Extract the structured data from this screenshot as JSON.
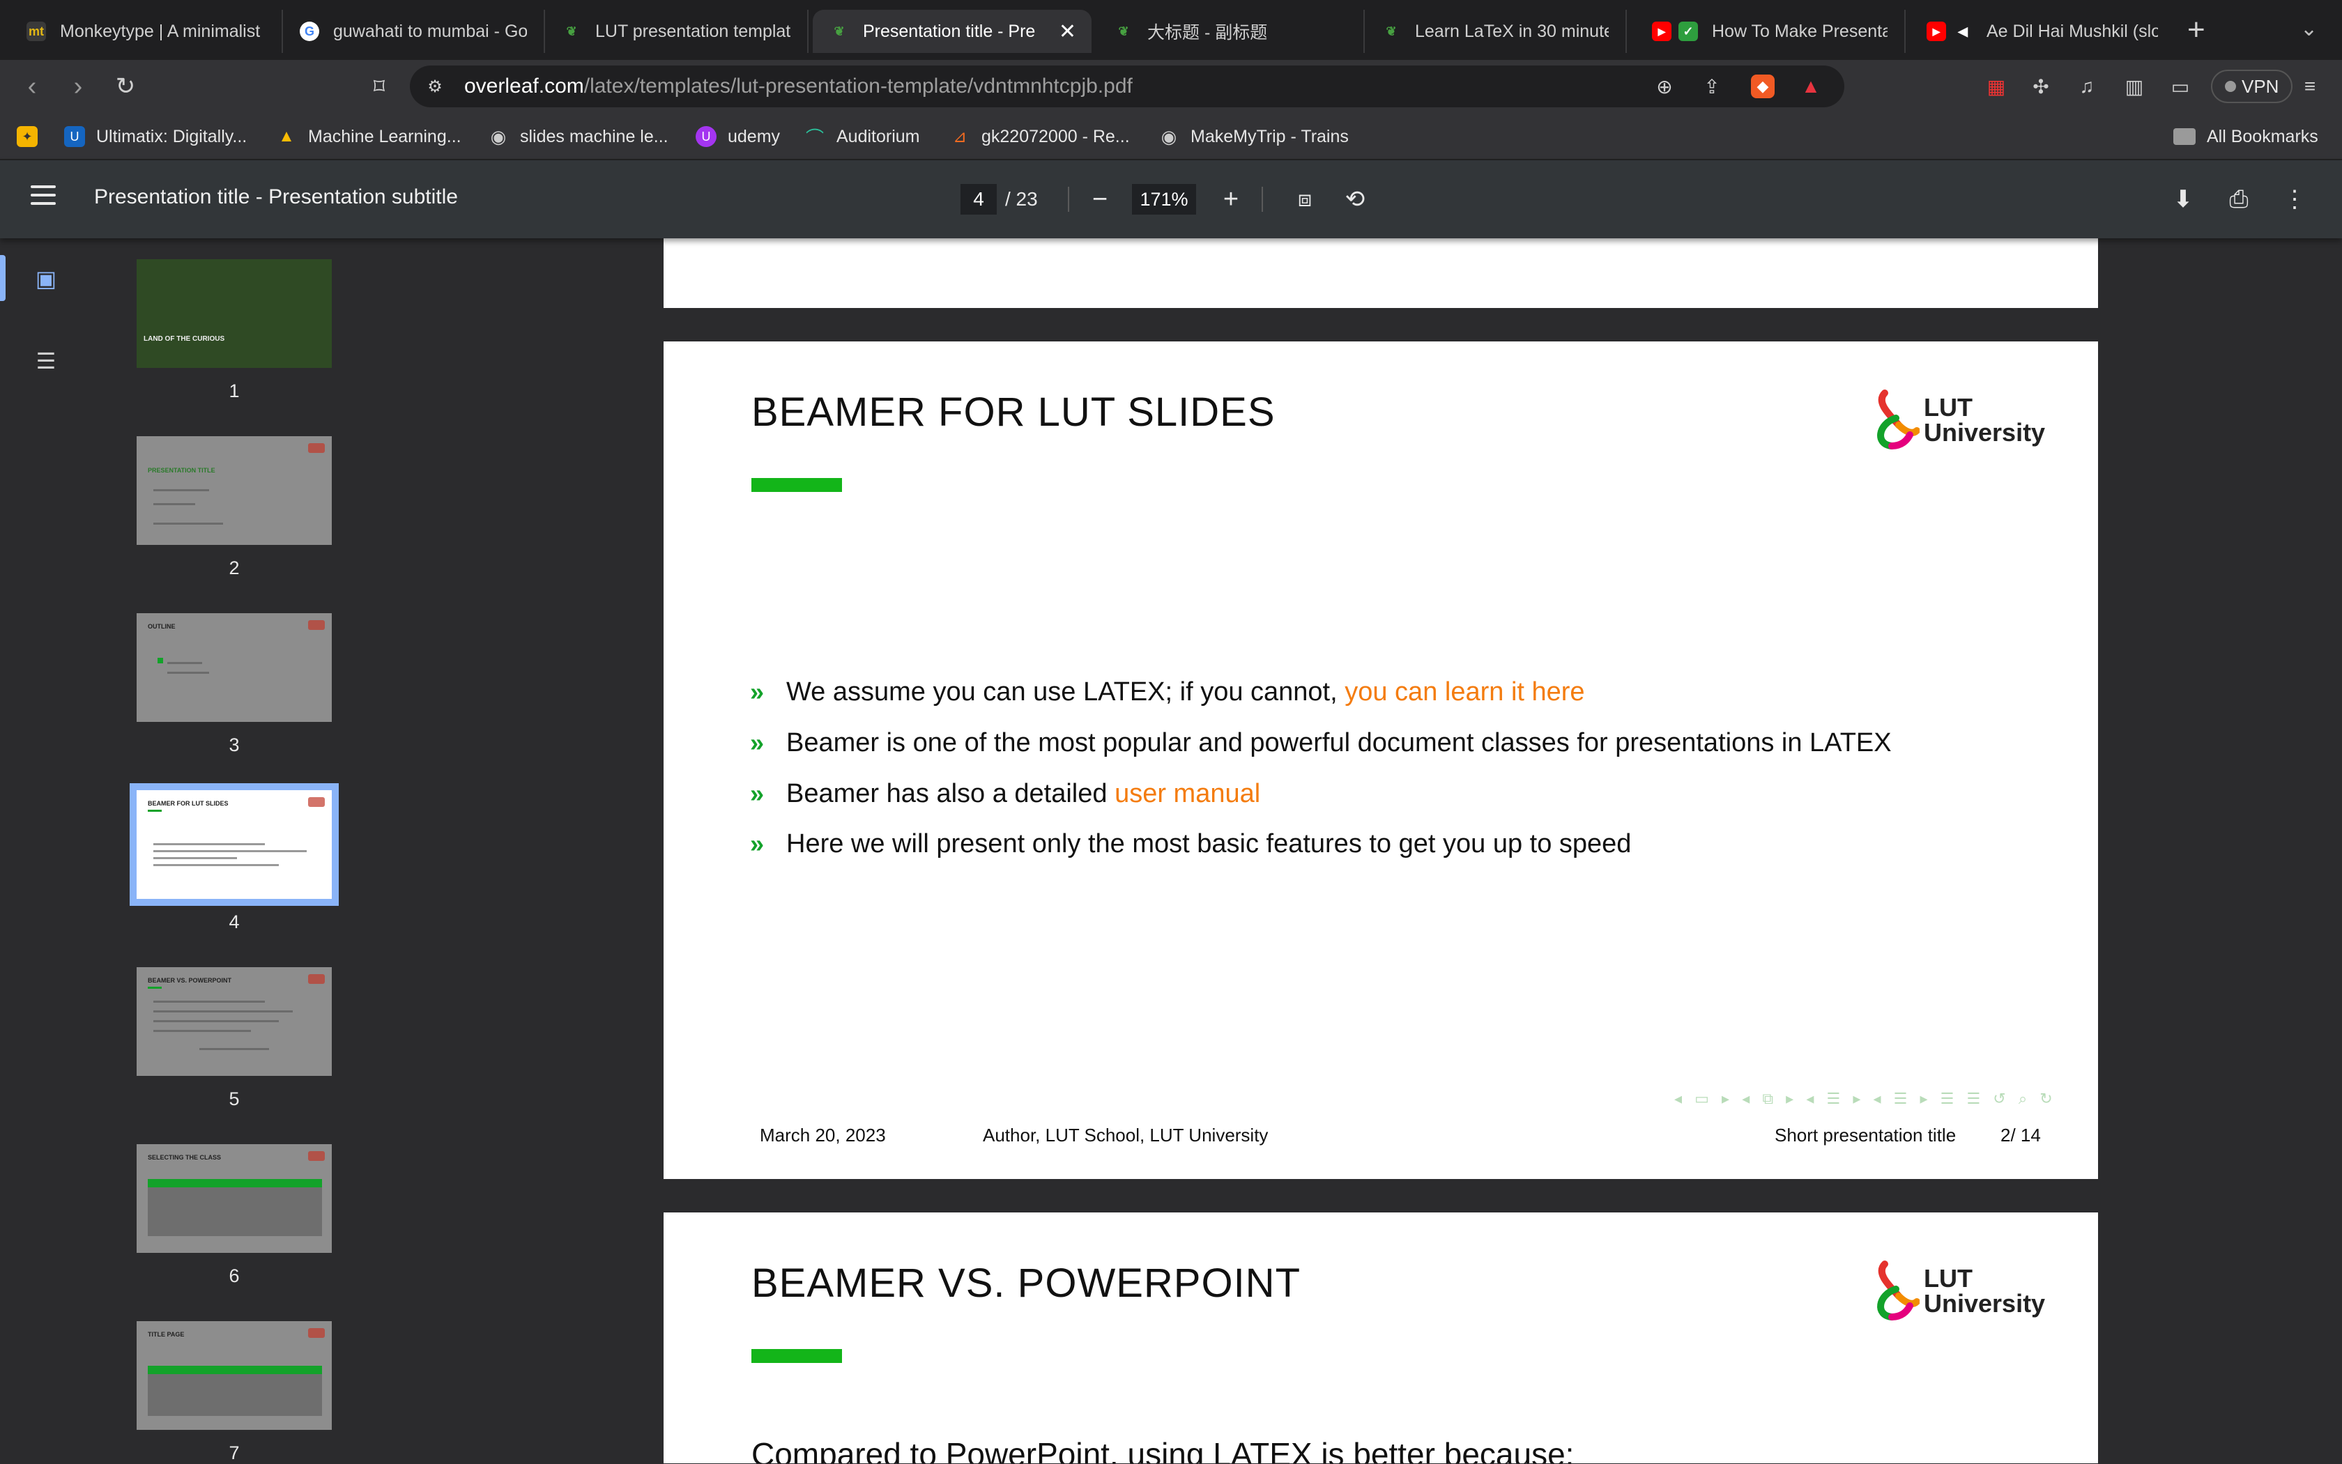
{
  "browser": {
    "tabs": [
      {
        "label": "Monkeytype | A minimalist",
        "icon": "monkeytype-icon"
      },
      {
        "label": "guwahati to mumbai - Goo",
        "icon": "google-icon"
      },
      {
        "label": "LUT presentation template",
        "icon": "overleaf-icon"
      },
      {
        "label": "Presentation title - Pre",
        "icon": "overleaf-icon",
        "active": true
      },
      {
        "label": "大标题 - 副标题",
        "icon": "overleaf-icon"
      },
      {
        "label": "Learn LaTeX in 30 minutes",
        "icon": "overleaf-icon"
      },
      {
        "label": "How To Make Presenta",
        "icon": "youtube-icon"
      },
      {
        "label": "Ae Dil Hai Mushkil (slo",
        "icon": "youtube-icon"
      }
    ],
    "url_host": "overleaf.com",
    "url_path": "/latex/templates/lut-presentation-template/vdntmnhtcpjb.pdf",
    "vpn_label": "VPN",
    "bookmarks": [
      {
        "label": "Ultimatix: Digitally..."
      },
      {
        "label": "Machine Learning..."
      },
      {
        "label": "slides machine le..."
      },
      {
        "label": "udemy"
      },
      {
        "label": "Auditorium"
      },
      {
        "label": "gk22072000 - Re..."
      },
      {
        "label": "MakeMyTrip - Trains"
      }
    ],
    "all_bookmarks": "All Bookmarks"
  },
  "pdf": {
    "title": "Presentation title - Presentation subtitle",
    "current_page": "4",
    "total_pages": "/ 23",
    "zoom": "171%"
  },
  "thumbnails": [
    {
      "num": "1",
      "title": "LAND OF THE CURIOUS"
    },
    {
      "num": "2",
      "title": "PRESENTATION TITLE"
    },
    {
      "num": "3",
      "title": "OUTLINE"
    },
    {
      "num": "4",
      "title": "BEAMER FOR LUT SLIDES",
      "selected": true
    },
    {
      "num": "5",
      "title": "BEAMER VS. POWERPOINT"
    },
    {
      "num": "6",
      "title": "SELECTING THE CLASS"
    },
    {
      "num": "7",
      "title": "TITLE PAGE"
    }
  ],
  "slide": {
    "title": "BEAMER FOR LUT SLIDES",
    "logo_line1": "LUT",
    "logo_line2": "University",
    "bullets": [
      {
        "text": "We assume you can use LATEX; if you cannot, ",
        "link": "you can learn it here"
      },
      {
        "text": "Beamer is one of the most popular and powerful document classes for presentations in LATEX",
        "link": ""
      },
      {
        "text": "Beamer has also a detailed ",
        "link": "user manual"
      },
      {
        "text": "Here we will present only the most basic features to get you up to speed",
        "link": ""
      }
    ],
    "footer_date": "March 20, 2023",
    "footer_author": "Author, LUT School, LUT University",
    "footer_short": "Short presentation title",
    "footer_page": "2/ 14"
  },
  "next_slide": {
    "title": "BEAMER VS. POWERPOINT",
    "logo_line1": "LUT",
    "logo_line2": "University",
    "subhead": "Compared to PowerPoint, using LATEX is better because:"
  },
  "colors": {
    "accent_green": "#13b519",
    "link_orange": "#f47c0f",
    "sidebar_highlight": "#8ab4f8"
  }
}
